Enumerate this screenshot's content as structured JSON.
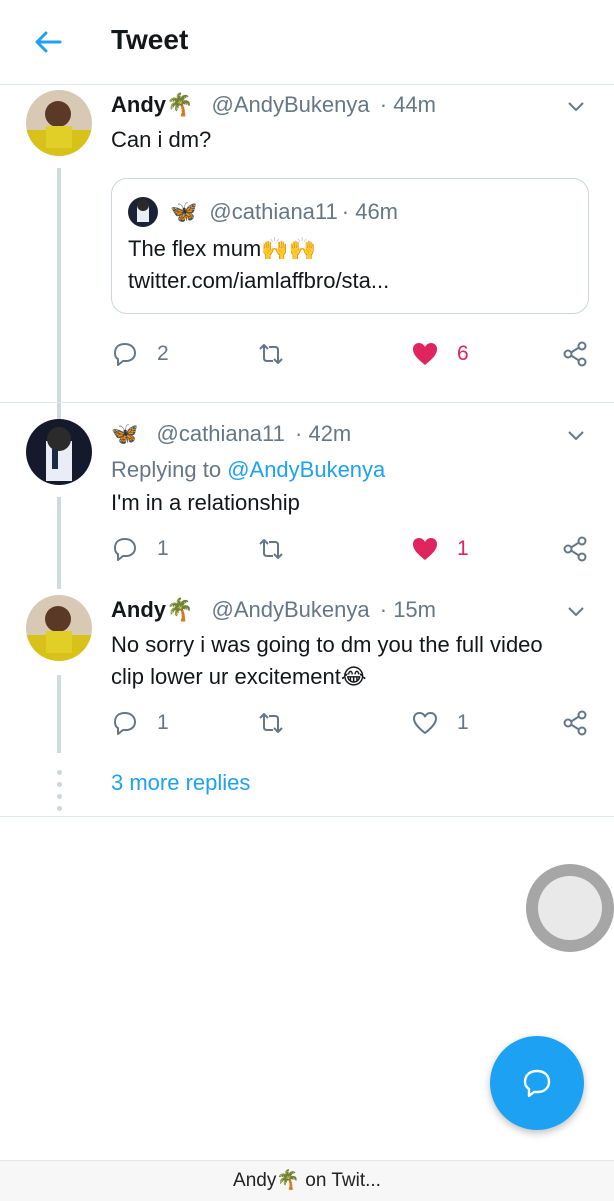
{
  "header": {
    "title": "Tweet"
  },
  "tweets": [
    {
      "name": "Andy🌴",
      "handle": "@AndyBukenya",
      "time": "· 44m",
      "text": "Can i dm?",
      "quote": {
        "name": "🦋",
        "handle": "@cathiana11",
        "time": "· 46m",
        "line1": "The flex mum🙌🙌",
        "line2": "twitter.com/iamlaffbro/sta..."
      },
      "replies": "2",
      "retweets": "",
      "likes": "6",
      "liked": true
    },
    {
      "name": "🦋",
      "handle": "@cathiana11",
      "time": "· 42m",
      "replying_prefix": "Replying to ",
      "replying_to": "@AndyBukenya",
      "text": "I'm in a relationship",
      "replies": "1",
      "retweets": "",
      "likes": "1",
      "liked": true
    },
    {
      "name": "Andy🌴",
      "handle": "@AndyBukenya",
      "time": "· 15m",
      "text_line1": "No sorry i was going to dm you the full video",
      "text_line2": "clip  lower ur excitement😂",
      "replies": "1",
      "retweets": "",
      "likes": "1",
      "liked": false
    }
  ],
  "more_replies": "3 more replies",
  "bottom_bar": "Andy🌴 on Twit...",
  "colors": {
    "accent": "#1da1f2",
    "like": "#e0245e",
    "muted": "#657786"
  }
}
